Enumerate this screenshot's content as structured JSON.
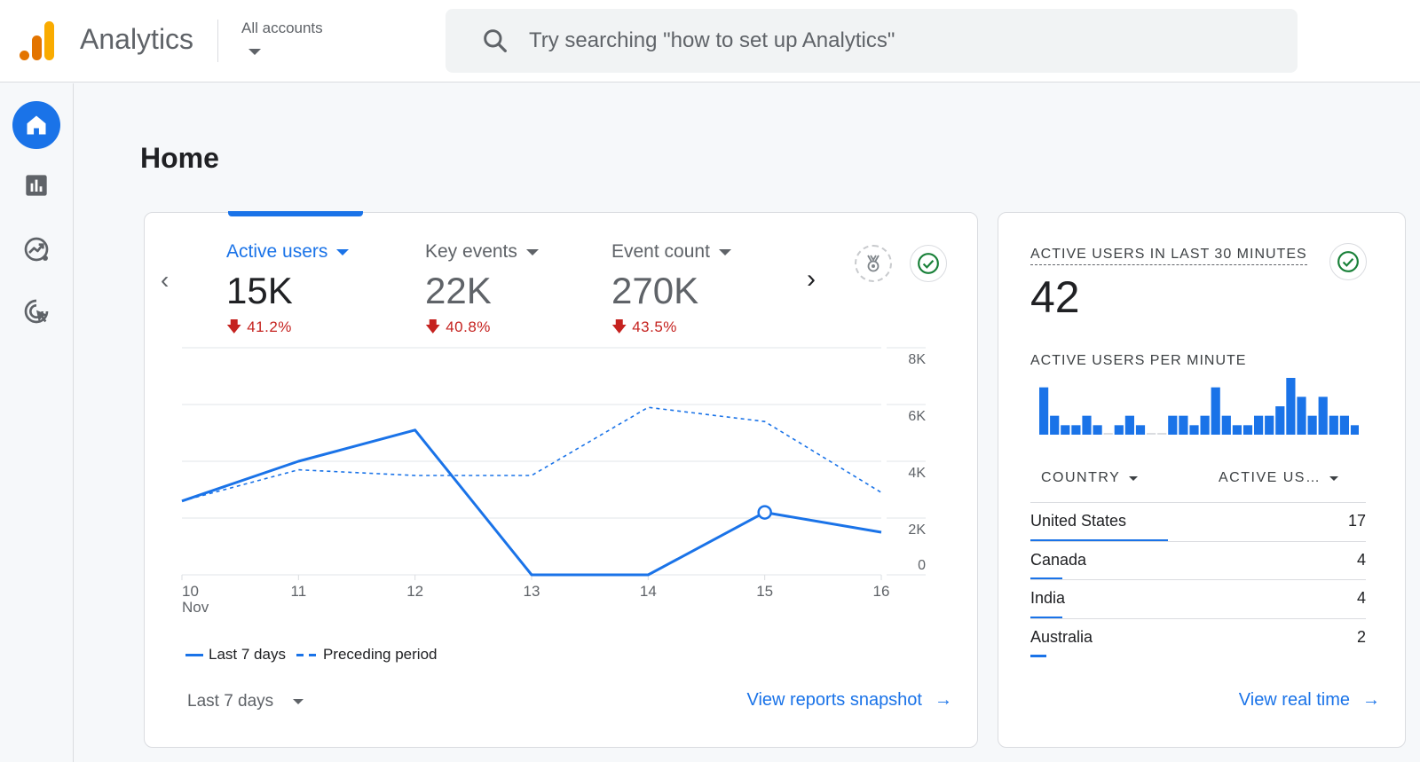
{
  "header": {
    "app_title": "Analytics",
    "account_label": "All accounts",
    "search_placeholder": "Try searching \"how to set up Analytics\""
  },
  "sidenav": {
    "items": [
      {
        "name": "home",
        "icon": "home-icon",
        "active": true
      },
      {
        "name": "reports",
        "icon": "bar-chart-icon",
        "active": false
      },
      {
        "name": "explore",
        "icon": "explore-icon",
        "active": false
      },
      {
        "name": "advertising",
        "icon": "target-cursor-icon",
        "active": false
      }
    ]
  },
  "page": {
    "title": "Home"
  },
  "overview_card": {
    "metrics": [
      {
        "label": "Active users",
        "value": "15K",
        "change": "41.2%",
        "direction": "down",
        "active": true
      },
      {
        "label": "Key events",
        "value": "22K",
        "change": "40.8%",
        "direction": "down",
        "active": false
      },
      {
        "label": "Event count",
        "value": "270K",
        "change": "43.5%",
        "direction": "down",
        "active": false
      }
    ],
    "date_range": "Last 7 days",
    "link_label": "View reports snapshot"
  },
  "realtime_card": {
    "title": "ACTIVE USERS IN LAST 30 MINUTES",
    "value": "42",
    "subtitle": "ACTIVE USERS PER MINUTE",
    "per_minute": [
      5,
      2,
      1,
      1,
      2,
      1,
      0,
      1,
      2,
      1,
      0,
      0,
      2,
      2,
      1,
      2,
      5,
      2,
      1,
      1,
      2,
      2,
      3,
      6,
      4,
      2,
      4,
      2,
      2,
      1
    ],
    "columns": [
      "COUNTRY",
      "ACTIVE US…"
    ],
    "rows": [
      {
        "country": "United States",
        "users": "17",
        "share": 1.0
      },
      {
        "country": "Canada",
        "users": "4",
        "share": 0.235
      },
      {
        "country": "India",
        "users": "4",
        "share": 0.235
      },
      {
        "country": "Australia",
        "users": "2",
        "share": 0.118
      }
    ],
    "link_label": "View real time"
  },
  "colors": {
    "accent": "#1a73e8",
    "negative": "#c5221f",
    "success": "#188038"
  },
  "chart_data": {
    "type": "line",
    "title": "",
    "x": [
      "10",
      "11",
      "12",
      "13",
      "14",
      "15",
      "16"
    ],
    "x_sublabel": "Nov",
    "xlabel": "",
    "ylabel": "",
    "ylim": [
      0,
      8000
    ],
    "yticks": [
      "0",
      "2K",
      "4K",
      "6K",
      "8K"
    ],
    "ytick_values": [
      0,
      2000,
      4000,
      6000,
      8000
    ],
    "grid": true,
    "legend_position": "bottom-left",
    "highlight_index": 5,
    "series": [
      {
        "name": "Last 7 days",
        "style": "solid",
        "values": [
          2600,
          4000,
          5100,
          0,
          0,
          2200,
          1500
        ]
      },
      {
        "name": "Preceding period",
        "style": "dashed",
        "values": [
          2600,
          3700,
          3500,
          3500,
          5900,
          5400,
          2900
        ]
      }
    ]
  }
}
